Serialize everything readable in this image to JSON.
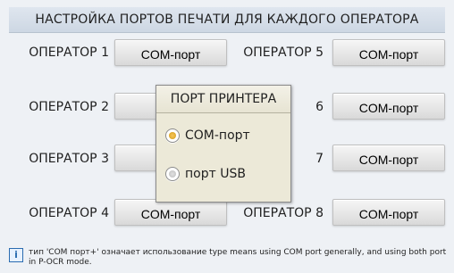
{
  "title": "НАСТРОЙКА ПОРТОВ ПЕЧАТИ ДЛЯ КАЖДОГО ОПЕРАТОРА",
  "left_operators": [
    {
      "label": "ОПЕРАТОР 1",
      "port": "COM-порт"
    },
    {
      "label": "ОПЕРАТОР 2",
      "port": "CO"
    },
    {
      "label": "ОПЕРАТОР 3",
      "port": "CO"
    },
    {
      "label": "ОПЕРАТОР 4",
      "port": "COM-порт"
    }
  ],
  "right_operators": [
    {
      "label": "ОПЕРАТОР 5",
      "port": "COM-порт"
    },
    {
      "label": "6",
      "port": "COM-порт"
    },
    {
      "label": "7",
      "port": "COM-порт"
    },
    {
      "label": "ОПЕРАТОР 8",
      "port": "COM-порт"
    }
  ],
  "dialog": {
    "title": "ПОРТ ПРИНТЕРА",
    "options": [
      {
        "label": "COM-порт",
        "selected": true
      },
      {
        "label": "порт USB",
        "selected": false
      }
    ]
  },
  "info": {
    "icon": "info-icon",
    "text": "тип 'COM порт+' означает использование type means using COM port generally, and using both port in P-OCR mode."
  }
}
